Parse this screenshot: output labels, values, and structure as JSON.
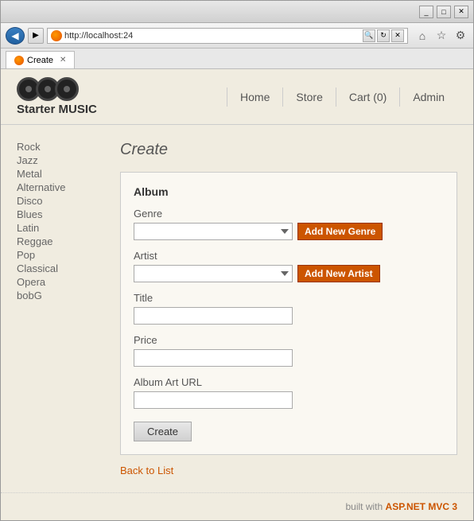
{
  "browser": {
    "title_bar_buttons": [
      "_",
      "□",
      "✕"
    ],
    "address": "http://localhost:24",
    "tab_label": "Create",
    "nav_buttons": {
      "back": "◀",
      "forward": "▶",
      "refresh": "↻",
      "stop": "✕",
      "search_placeholder": "🔍"
    },
    "right_nav": [
      "⌂",
      "☆",
      "⚙"
    ]
  },
  "site": {
    "title": "Starter MUSIC",
    "nav": [
      {
        "label": "Home",
        "href": "#"
      },
      {
        "label": "Store",
        "href": "#"
      },
      {
        "label": "Cart (0)",
        "href": "#"
      },
      {
        "label": "Admin",
        "href": "#"
      }
    ]
  },
  "sidebar": {
    "items": [
      {
        "label": "Rock"
      },
      {
        "label": "Jazz"
      },
      {
        "label": "Metal"
      },
      {
        "label": "Alternative"
      },
      {
        "label": "Disco"
      },
      {
        "label": "Blues"
      },
      {
        "label": "Latin"
      },
      {
        "label": "Reggae"
      },
      {
        "label": "Pop"
      },
      {
        "label": "Classical"
      },
      {
        "label": "Opera"
      },
      {
        "label": "bobG"
      }
    ]
  },
  "main": {
    "page_title": "Create",
    "form": {
      "legend": "Album",
      "genre_label": "Genre",
      "genre_add_btn": "Add New Genre",
      "artist_label": "Artist",
      "artist_add_btn": "Add New Artist",
      "title_label": "Title",
      "price_label": "Price",
      "album_art_label": "Album Art URL",
      "create_btn": "Create"
    },
    "back_link": "Back to List"
  },
  "footer": {
    "text": "built with",
    "link_text": "ASP.NET MVC 3"
  }
}
